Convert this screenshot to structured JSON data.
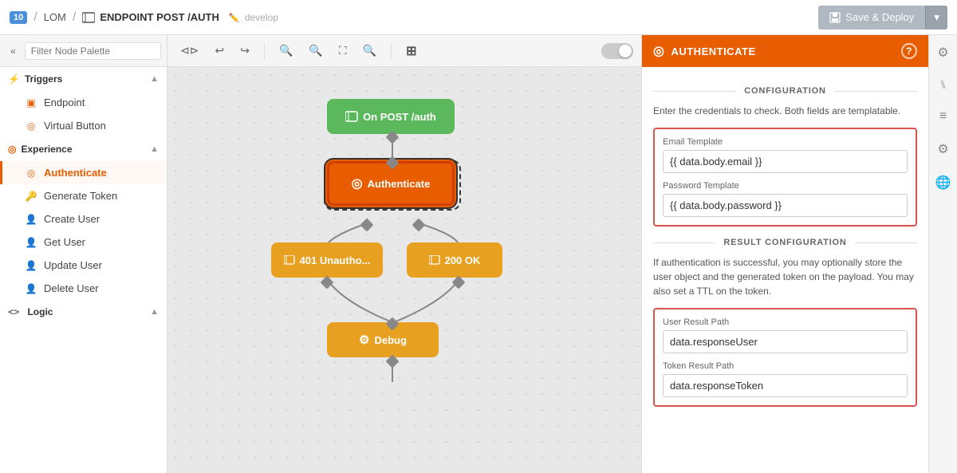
{
  "topbar": {
    "badge": "10",
    "lom": "LOM",
    "sep": "/",
    "title": "ENDPOINT POST /AUTH",
    "branch": "develop",
    "save_deploy": "Save & Deploy"
  },
  "sidebar": {
    "filter_placeholder": "Filter Node Palette",
    "sections": [
      {
        "id": "triggers",
        "label": "Triggers",
        "icon": "⚡",
        "items": [
          {
            "id": "endpoint",
            "label": "Endpoint",
            "icon": "🔲"
          },
          {
            "id": "virtual-button",
            "label": "Virtual Button",
            "icon": "⊙"
          }
        ]
      },
      {
        "id": "experience",
        "label": "Experience",
        "icon": "⊙",
        "items": [
          {
            "id": "authenticate",
            "label": "Authenticate",
            "icon": "⊙",
            "active": true
          },
          {
            "id": "generate-token",
            "label": "Generate Token",
            "icon": "🔑"
          },
          {
            "id": "create-user",
            "label": "Create User",
            "icon": "👤"
          },
          {
            "id": "get-user",
            "label": "Get User",
            "icon": "👤"
          },
          {
            "id": "update-user",
            "label": "Update User",
            "icon": "👤"
          },
          {
            "id": "delete-user",
            "label": "Delete User",
            "icon": "👤"
          }
        ]
      },
      {
        "id": "logic",
        "label": "Logic",
        "icon": "<>",
        "items": []
      }
    ]
  },
  "canvas": {
    "nodes": [
      {
        "id": "on-post",
        "label": "On POST /auth",
        "type": "trigger",
        "icon": "🔲"
      },
      {
        "id": "authenticate",
        "label": "Authenticate",
        "type": "experience",
        "icon": "⊙"
      },
      {
        "id": "401",
        "label": "401 Unautho...",
        "type": "response",
        "icon": "🔲"
      },
      {
        "id": "200",
        "label": "200 OK",
        "type": "response",
        "icon": "🔲"
      },
      {
        "id": "debug",
        "label": "Debug",
        "type": "debug",
        "icon": "⚙"
      }
    ]
  },
  "right_panel": {
    "title": "AUTHENTICATE",
    "config_section": "CONFIGURATION",
    "config_desc": "Enter the credentials to check. Both fields are templatable.",
    "email_label": "Email Template",
    "email_value": "{{ data.body.email }}",
    "password_label": "Password Template",
    "password_value": "{{ data.body.password }}",
    "result_section": "RESULT CONFIGURATION",
    "result_desc": "If authentication is successful, you may optionally store the user object and the generated token on the payload. You may also set a TTL on the token.",
    "user_result_label": "User Result Path",
    "user_result_value": "data.responseUser",
    "token_result_label": "Token Result Path",
    "token_result_value": "data.responseToken"
  },
  "icons": {
    "settings": "⚙",
    "plug": "⑊",
    "stack": "≡",
    "sliders": "⚙",
    "globe": "🌐"
  }
}
